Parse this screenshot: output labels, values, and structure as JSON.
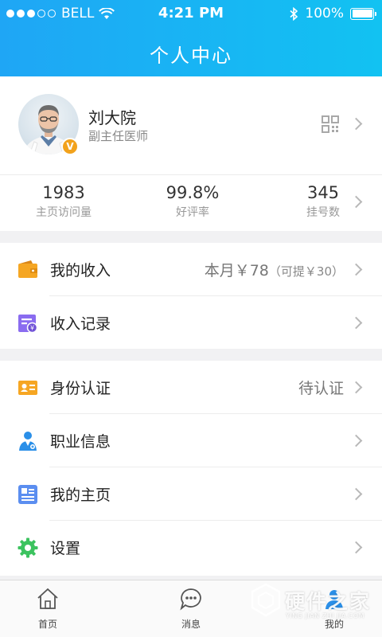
{
  "status_bar": {
    "carrier": "BELL",
    "time": "4:21 PM",
    "battery": "100%",
    "signal_bars_filled": 3,
    "signal_bars_total": 5
  },
  "header": {
    "title": "个人中心"
  },
  "profile": {
    "name": "刘大院",
    "title": "副主任医师",
    "badge": "V"
  },
  "stats": [
    {
      "value": "1983",
      "label": "主页访问量"
    },
    {
      "value": "99.8%",
      "label": "好评率"
    },
    {
      "value": "345",
      "label": "挂号数"
    }
  ],
  "income_group": [
    {
      "label": "我的收入",
      "value_main": "本月￥78",
      "value_sub": "（可提￥30）",
      "icon": "wallet-icon"
    },
    {
      "label": "收入记录",
      "icon": "income-record-icon"
    }
  ],
  "settings_group": [
    {
      "label": "身份认证",
      "value": "待认证",
      "icon": "id-card-icon"
    },
    {
      "label": "职业信息",
      "icon": "doctor-icon"
    },
    {
      "label": "我的主页",
      "icon": "homepage-icon"
    },
    {
      "label": "设置",
      "icon": "gear-icon"
    }
  ],
  "tabbar": [
    {
      "label": "首页",
      "icon": "home-icon"
    },
    {
      "label": "消息",
      "icon": "message-icon"
    },
    {
      "label": "我的",
      "icon": "profile-icon"
    }
  ],
  "watermark": {
    "text": "硬件之家",
    "sub": "YING JIAN ZHI JIA.COM"
  },
  "colors": {
    "header_start": "#1fa6f5",
    "header_end": "#12c2f2",
    "wallet": "#f5a623",
    "purple": "#8a6cf0",
    "green": "#3cc35f",
    "id_orange": "#f6a623"
  }
}
